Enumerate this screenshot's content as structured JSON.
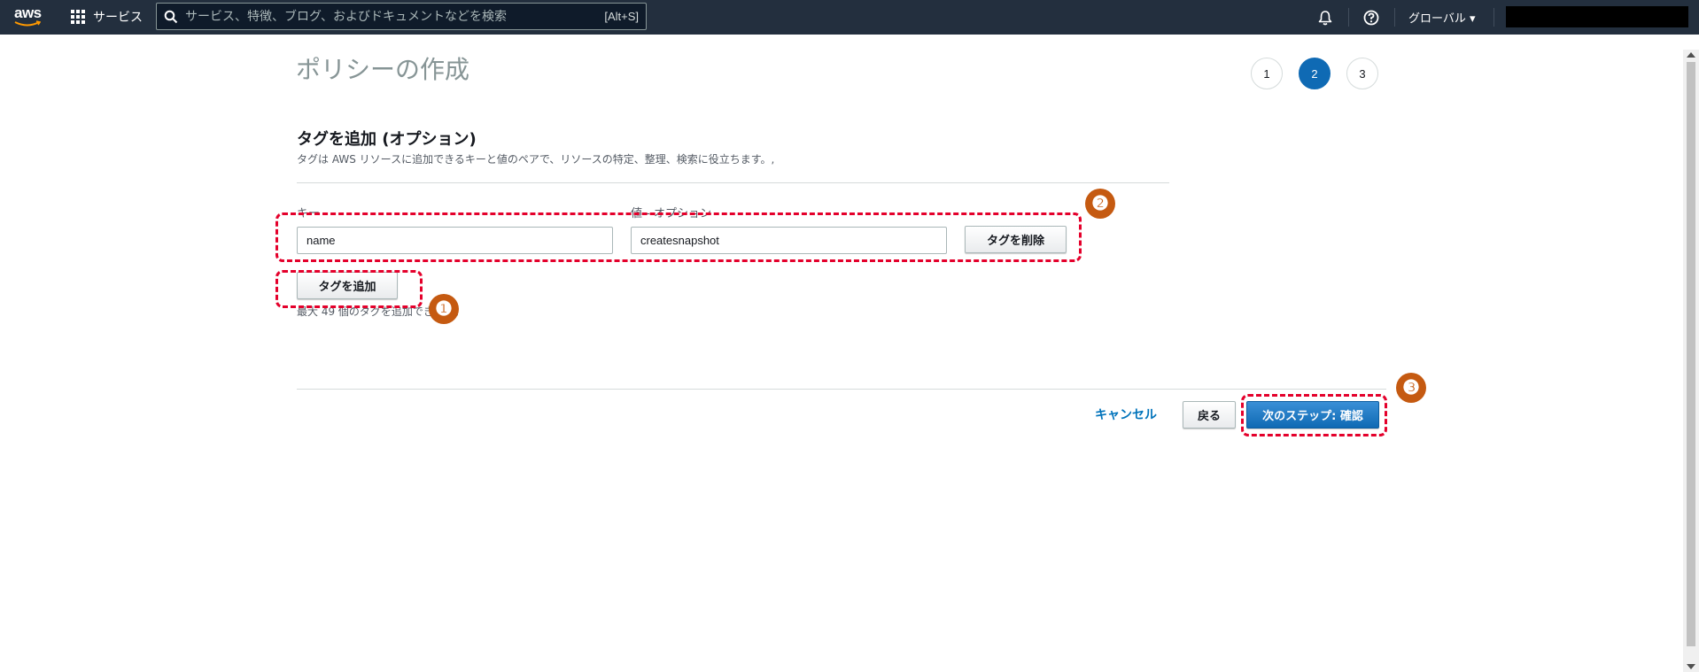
{
  "nav": {
    "logo_text": "aws",
    "services_label": "サービス",
    "search_placeholder": "サービス、特徴、ブログ、およびドキュメントなどを検索",
    "search_shortcut": "[Alt+S]",
    "region_label": "グローバル ▾"
  },
  "page": {
    "title": "ポリシーの作成",
    "steps": [
      {
        "label": "1",
        "active": false
      },
      {
        "label": "2",
        "active": true
      },
      {
        "label": "3",
        "active": false
      }
    ]
  },
  "tags": {
    "title": "タグを追加 (オプション)",
    "description": "タグは AWS リソースに追加できるキーと値のペアで、リソースの特定、整理、検索に役立ちます。,",
    "key_label": "キー",
    "value_label": "値 - オプション",
    "rows": [
      {
        "key": "name",
        "value": "createsnapshot",
        "remove_label": "タグを削除"
      }
    ],
    "add_label": "タグを追加",
    "hint": "最大 49 個のタグを追加できます。"
  },
  "footer": {
    "cancel_label": "キャンセル",
    "back_label": "戻る",
    "next_label": "次のステップ: 確認"
  },
  "annotations": {
    "badge_1": "❶",
    "badge_2": "❷",
    "badge_3": "❸",
    "color": "#e4002b",
    "badge_color": "#c55a11"
  },
  "colors": {
    "nav_bg": "#232f3e",
    "primary": "#0f6ab4",
    "link": "#0073bb"
  }
}
